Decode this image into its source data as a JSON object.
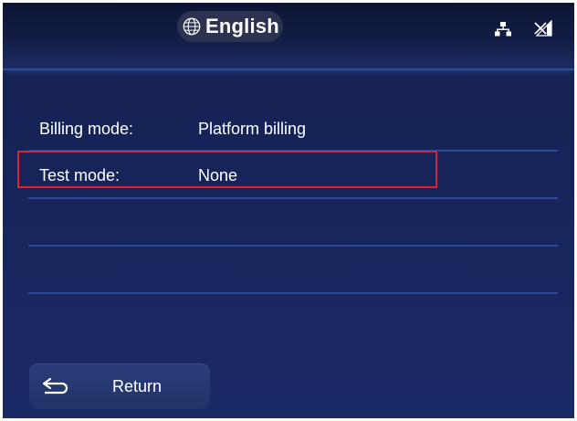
{
  "header": {
    "language_label": "English",
    "language_icon": "globe-icon",
    "network_icon": "network-icon",
    "signal_icon": "no-signal-icon"
  },
  "settings": [
    {
      "label": "Billing mode:",
      "value": "Platform billing"
    },
    {
      "label": "Test mode:",
      "value": "None"
    }
  ],
  "footer": {
    "return_label": "Return",
    "return_icon": "return-arrow-icon"
  },
  "colors": {
    "background": "#17245a",
    "separator": "#2a4a9c",
    "highlight": "#e0202c",
    "text": "#ffffff"
  }
}
